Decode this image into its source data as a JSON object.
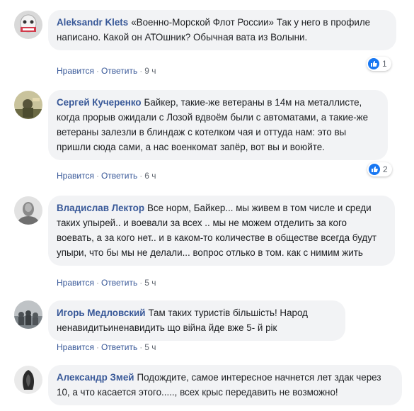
{
  "colors": {
    "author": "#385898",
    "bubble": "#f2f3f5",
    "like": "#1877f2",
    "meta": "#616770"
  },
  "action_labels": {
    "like": "Нравится",
    "reply": "Ответить"
  },
  "comments": [
    {
      "author": "Aleksandr Klets",
      "text": "«Военно-Морской Флот России» Так у него в профиле написано. Какой он АТОшник? Обычная вата из Волыни.",
      "time": "9 ч",
      "reactions": "1",
      "avatar_icon": "avatar-red-white-icon"
    },
    {
      "author": "Сергей Кучеренко",
      "text": "Байкер, такие-же ветераны в 14м на металлисте, когда прорыв ожидали с Лозой вдвоём были с автоматами, а такие-же ветераны залезли в блиндаж с котелком чая и оттуда нам: это вы пришли сюда сами, а нас военкомат запёр, вот вы и воюйте.",
      "time": "6 ч",
      "reactions": "2",
      "avatar_icon": "avatar-soldier-icon"
    },
    {
      "author": "Владислав Лектор",
      "text": "Все норм, Байкер... мы живем в том числе и среди таких упырей.. и воевали за всех .. мы не можем отделить за кого воевать, а за кого нет.. и в каком-то количестве в обществе всегда будут упыри, что бы мы не делали... вопрос отлько в том. как с нимим жить",
      "time": "5 ч",
      "reactions": "",
      "avatar_icon": "avatar-portrait-icon"
    },
    {
      "author": "Игорь Медловский",
      "text": "Там таких туристів більшість! Народ ненавидитьиненавидить що війна йде вже 5- й рік",
      "time": "5 ч",
      "reactions": "",
      "avatar_icon": "avatar-group-icon"
    },
    {
      "author": "Александр Змей",
      "text": "Подождите, самое интересное начнется лет здак через 10, а что касается этого....., всех крыс передавить не возможно!",
      "time": "",
      "reactions": "",
      "avatar_icon": "avatar-dark-icon"
    }
  ]
}
